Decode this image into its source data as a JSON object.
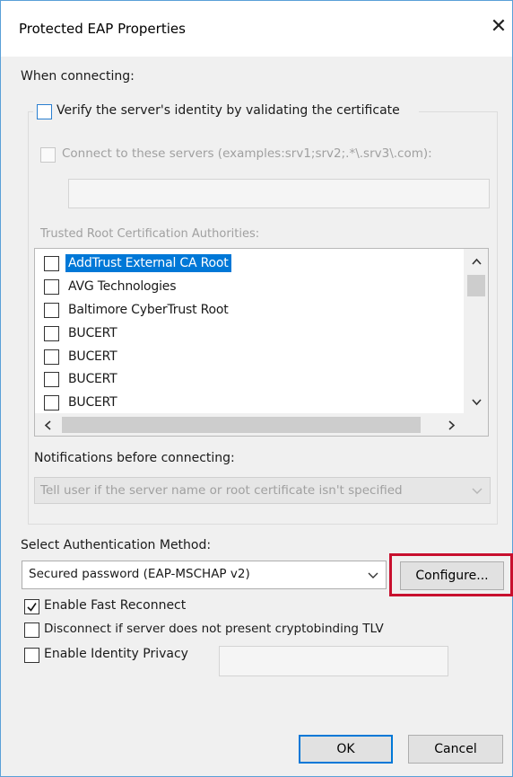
{
  "window": {
    "title": "Protected EAP Properties",
    "close_glyph": "✕"
  },
  "when_connecting": {
    "label": "When connecting:",
    "verify_identity": {
      "label": "Verify the server's identity by validating the certificate",
      "checked": false
    },
    "connect_servers": {
      "label": "Connect to these servers (examples:srv1;srv2;.*\\.srv3\\.com):",
      "checked": false,
      "value": ""
    },
    "trusted_root_label": "Trusted Root Certification Authorities:",
    "trusted_roots": [
      {
        "name": "AddTrust External CA Root",
        "checked": false,
        "selected": true
      },
      {
        "name": "AVG Technologies",
        "checked": false,
        "selected": false
      },
      {
        "name": "Baltimore CyberTrust Root",
        "checked": false,
        "selected": false
      },
      {
        "name": "BUCERT",
        "checked": false,
        "selected": false
      },
      {
        "name": "BUCERT",
        "checked": false,
        "selected": false
      },
      {
        "name": "BUCERT",
        "checked": false,
        "selected": false
      },
      {
        "name": "BUCERT",
        "checked": false,
        "selected": false
      }
    ],
    "notifications_label": "Notifications before connecting:",
    "notifications_value": "Tell user if the server name or root certificate isn't specified"
  },
  "auth": {
    "label": "Select Authentication Method:",
    "method_value": "Secured password (EAP-MSCHAP v2)",
    "configure_label": "Configure..."
  },
  "options": {
    "fast_reconnect": {
      "label": "Enable Fast Reconnect",
      "checked": true
    },
    "disconnect_tlv": {
      "label": "Disconnect if server does not present cryptobinding TLV",
      "checked": false
    },
    "identity_privacy": {
      "label": "Enable Identity Privacy",
      "checked": false,
      "value": ""
    }
  },
  "buttons": {
    "ok_label": "OK",
    "cancel_label": "Cancel"
  },
  "colors": {
    "selection": "#0078d7",
    "highlight_box": "#c8102e",
    "window_border": "#5aa0d8"
  }
}
